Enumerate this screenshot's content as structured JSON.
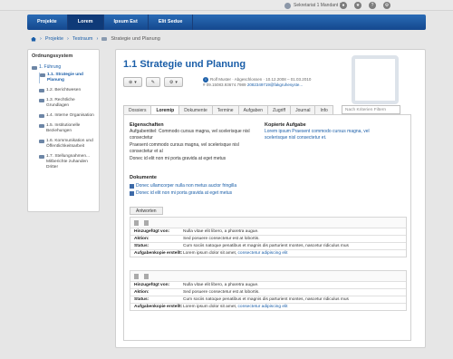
{
  "topbar": {
    "user": "Sekretariat 1 Mandant 1 ▾"
  },
  "nav": {
    "tabs": [
      "Projekte",
      "Lorem",
      "Ipsum Est",
      "Elit Sedue"
    ]
  },
  "breadcrumb": {
    "home": "",
    "projekte": "Projekte",
    "sep1": "›",
    "testraum": "Testraum",
    "sep2": "›",
    "current": "Strategie und Planung"
  },
  "sidebar": {
    "title": "Ordnungssystem",
    "root": "1. Führung",
    "items": [
      "1.1. Strategie und Planung",
      "1.2. Berichtwesen",
      "1.3. Rechtliche Grundlagen",
      "1.4. Interne Organisation",
      "1.5. Institutionelle Beziehungen",
      "1.6. Kommunikation und Öffentlichkeitsarbeit",
      "1.7. Stellungnahmen... Mitberichte zuhanden Dritter"
    ]
  },
  "main": {
    "title": "1.1 Strategie und Planung",
    "meta_line1": "Rolf Muster · Abgeschlossen · 10.12.2008 – 01.03.2010",
    "meta_line2": "# 09.15083.93674.7989",
    "meta_link": "2082349719@fakgruhesyste...",
    "tabs": [
      "Dossiers",
      "Loremip",
      "Dokumente",
      "Termine",
      "Aufgaben",
      "Zugriff",
      "Journal",
      "Info"
    ],
    "filter_placeholder": "Nach Kriterien Filtern",
    "eigenschaften": {
      "heading": "Eigenschaften",
      "line1": "Aufgabentitel: Commodo cursus magna, vel scelerisque nisl consectetur",
      "line2": "Praesent commodo cursus magna, vel scelerisque nisl consectetur et al",
      "line3": "Donec id elit non mi porta gravida at eget metus"
    },
    "kopierte": {
      "heading": "Kopierte Aufgabe",
      "text": "Lorem ipsum Praesent commodo cursus magna, vel scelerisque nisl consectetur et."
    },
    "dokumente": {
      "heading": "Dokumente",
      "items": [
        "Donec ullamcorper nulla non metus auctor fringilla",
        "Donec id elit non mi porta gravida at eget metus"
      ]
    },
    "antworten_tab": "Antworten",
    "answers": [
      {
        "hinzugefuegt_label": "Hinzugefügt von:",
        "hinzugefuegt": "Nulla vitae elit libero, a pharetra augue.",
        "aktion_label": "Aktion:",
        "aktion": "Sed posuere consectetur est at lobortis.",
        "status_label": "Status:",
        "status": "Cum sociis natoque penatibus et magnis dis parturient montes, nascetur ridiculus mus",
        "kopie_label": "Aufgabenkopie erstellt:",
        "kopie": "Lorem ipsum dolor sit amet, ",
        "kopie_link": "consectetur adipiscing elit"
      },
      {
        "hinzugefuegt_label": "Hinzugefügt von:",
        "hinzugefuegt": "Nulla vitae elit libero, a pharetra augue.",
        "aktion_label": "Aktion:",
        "aktion": "Sed posuere consectetur est at lobortis.",
        "status_label": "Status:",
        "status": "Cum sociis natoque penatibus et magnis dis parturient montes, nascetur ridiculus mus",
        "kopie_label": "Aufgabenkopie erstellt:",
        "kopie": "Lorem ipsum dolor sit amet, ",
        "kopie_link": "consectetur adipiscing elit"
      }
    ]
  },
  "colors": {
    "accent": "#1a5ea8",
    "nav": "#14488e"
  }
}
